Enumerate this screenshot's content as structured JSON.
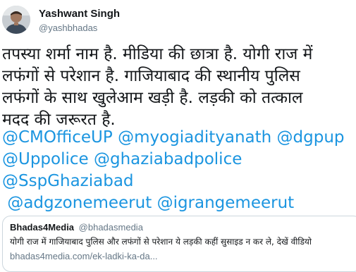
{
  "author": {
    "display_name": "Yashwant Singh",
    "handle": "@yashbhadas"
  },
  "tweet": {
    "text_lines": [
      "तपस्या शर्मा नाम है. मीडिया की छात्रा है. योगी राज में",
      "लफंगों से परेशान है. गाजियाबाद की स्थानीय पुलिस",
      "लफंगों के साथ खुलेआम खड़ी है. लड़की को तत्काल",
      "मदद की जरूरत है."
    ],
    "mentions": [
      "@CMOfficeUP",
      "@myogiadityanath",
      "@dgpup",
      "@Uppolice",
      "@ghaziabadpolice",
      "@SspGhaziabad",
      "@adgzonemeerut",
      "@igrangemeerut"
    ]
  },
  "quoted_tweet": {
    "display_name": "Bhadas4Media",
    "handle": "@bhadasmedia",
    "text": "योगी राज में गाजियाबाद पुलिस और लफंगों से परेशान ये लड़की कहीं सुसाइड न कर ले, देखें वीडियो",
    "link": "bhadas4media.com/ek-ladki-ka-da..."
  },
  "icons": [
    "avatar"
  ],
  "colors": {
    "text": "#14171a",
    "muted": "#657786",
    "mention": "#1b95e0",
    "border": "#ccd6dd"
  }
}
